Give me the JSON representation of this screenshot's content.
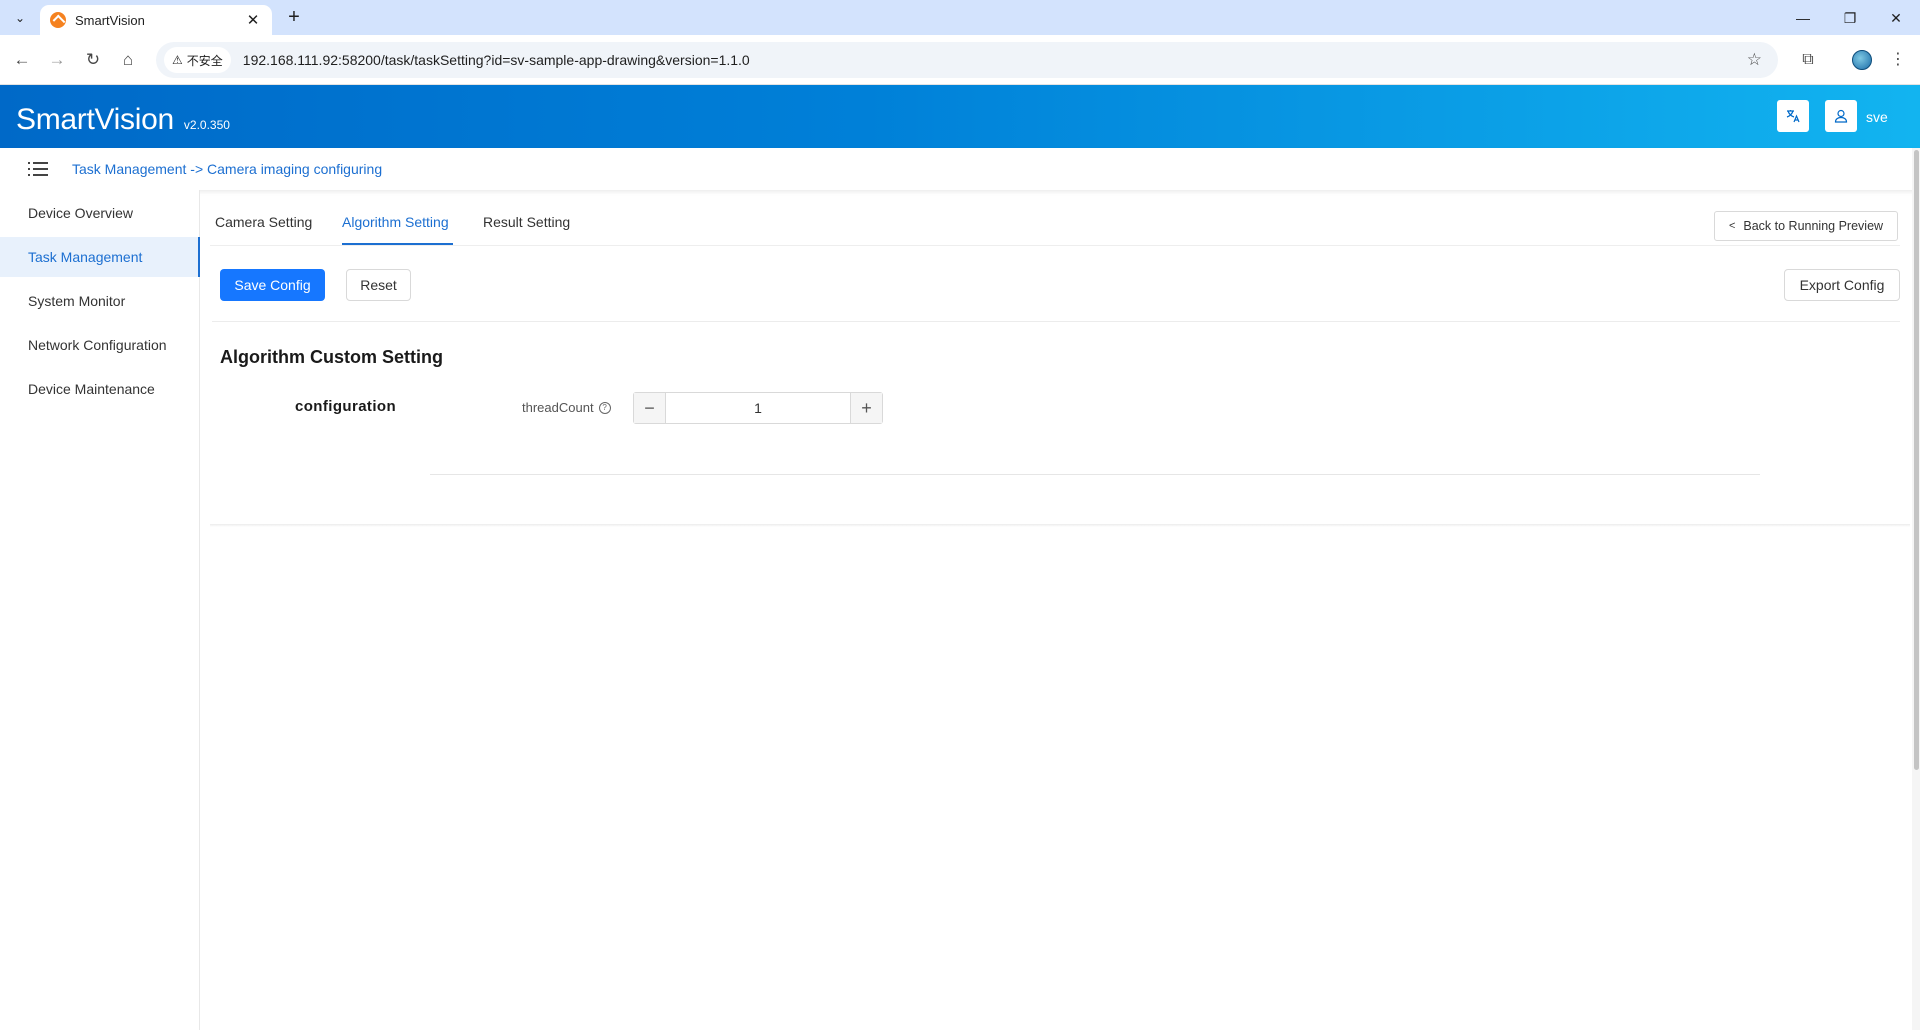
{
  "browser": {
    "tab_title": "SmartVision",
    "insecure_label": "不安全",
    "url": "192.168.111.92:58200/task/taskSetting?id=sv-sample-app-drawing&version=1.1.0"
  },
  "header": {
    "brand": "SmartVision",
    "version": "v2.0.350",
    "username": "sve",
    "gradient_start": "#0069c8",
    "gradient_end": "#12b4f0"
  },
  "breadcrumb": "Task Management -> Camera imaging configuring",
  "sidebar": {
    "items": [
      {
        "label": "Device Overview",
        "active": false
      },
      {
        "label": "Task Management",
        "active": true
      },
      {
        "label": "System Monitor",
        "active": false
      },
      {
        "label": "Network Configuration",
        "active": false
      },
      {
        "label": "Device Maintenance",
        "active": false
      }
    ]
  },
  "tabs": [
    {
      "label": "Camera Setting",
      "active": false
    },
    {
      "label": "Algorithm Setting",
      "active": true
    },
    {
      "label": "Result Setting",
      "active": false
    }
  ],
  "actions": {
    "back": "Back to Running Preview",
    "save": "Save Config",
    "reset": "Reset",
    "export": "Export Config"
  },
  "section": {
    "title": "Algorithm Custom Setting",
    "group": "configuration",
    "field_label": "threadCount",
    "field_value": "1"
  },
  "colors": {
    "primary": "#1677ff",
    "link": "#1c6fd1"
  }
}
